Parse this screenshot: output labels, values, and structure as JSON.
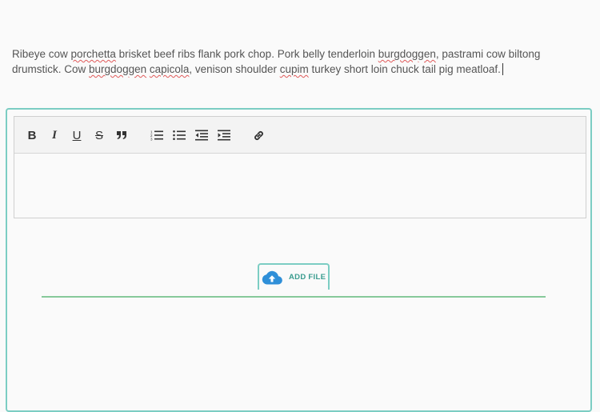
{
  "toolbar": {
    "buttons": [
      {
        "name": "bold-button",
        "icon": "bold-icon",
        "glyph": "B"
      },
      {
        "name": "italic-button",
        "icon": "italic-icon",
        "glyph": "I"
      },
      {
        "name": "underline-button",
        "icon": "underline-icon",
        "glyph": "U"
      },
      {
        "name": "strikethrough-button",
        "icon": "strikethrough-icon",
        "glyph": "S"
      },
      {
        "name": "blockquote-button",
        "icon": "quote-icon"
      },
      {
        "name": "ordered-list-button",
        "icon": "ordered-list-icon"
      },
      {
        "name": "bulleted-list-button",
        "icon": "bulleted-list-icon"
      },
      {
        "name": "outdent-button",
        "icon": "outdent-icon"
      },
      {
        "name": "indent-button",
        "icon": "indent-icon"
      },
      {
        "name": "link-button",
        "icon": "link-icon"
      }
    ]
  },
  "editor": {
    "text_segments": [
      "Ribeye cow ",
      "porchetta",
      " brisket beef ribs flank pork chop. Pork belly tenderloin ",
      "burgdoggen",
      ", pastrami cow biltong drumstick. Cow ",
      "burgdoggen",
      " ",
      "capicola",
      ", venison shoulder ",
      "cupim",
      " turkey short loin chuck tail pig meatloaf."
    ]
  },
  "upload": {
    "button_label": "ADD FILE",
    "icon": "cloud-upload-icon"
  },
  "colors": {
    "panel_border": "#7ccdc3",
    "accent_text": "#3a9c8f",
    "cloud_icon": "#2f8fd8",
    "underline_bar": "#86c99a",
    "misspelling_underline": "#e05a5a"
  }
}
